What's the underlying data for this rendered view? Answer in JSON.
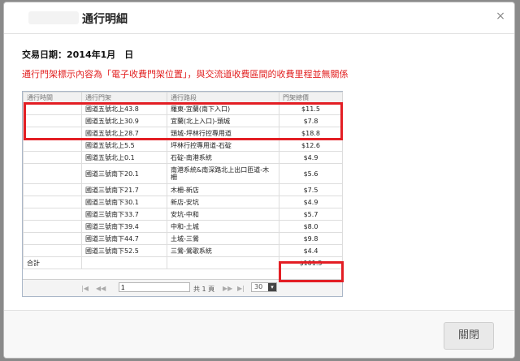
{
  "dialog": {
    "title": "通行明細",
    "close_icon": "×",
    "trade_date_label": "交易日期：2014年1月　日",
    "notice": "通行門架標示內容為「電子收費門架位置」，與交流道收費區間的收費里程並無關係"
  },
  "table": {
    "headers": [
      "通行時間",
      "通行門架",
      "通行路段",
      "門架總價"
    ],
    "rows": [
      {
        "time": "",
        "gantry": "國道五號北上43.8",
        "section": "羅東-宜蘭(南下入口)",
        "amount": "$11.5"
      },
      {
        "time": "",
        "gantry": "國道五號北上30.9",
        "section": "宜蘭(北上入口)-頭城",
        "amount": "$7.8"
      },
      {
        "time": "",
        "gantry": "國道五號北上28.7",
        "section": "頭城-坪林行控專用道",
        "amount": "$18.8"
      },
      {
        "time": "",
        "gantry": "國道五號北上5.5",
        "section": "坪林行控專用道-石碇",
        "amount": "$12.6"
      },
      {
        "time": "",
        "gantry": "國道五號北上0.1",
        "section": "石碇-南港系統",
        "amount": "$4.9"
      },
      {
        "time": "",
        "gantry": "國道三號南下20.1",
        "section": "南港系統&南深路北上出口匝道-木柵",
        "amount": "$5.6"
      },
      {
        "time": "",
        "gantry": "國道三號南下21.7",
        "section": "木柵-新店",
        "amount": "$7.5"
      },
      {
        "time": "",
        "gantry": "國道三號南下30.1",
        "section": "新店-安坑",
        "amount": "$4.9"
      },
      {
        "time": "",
        "gantry": "國道三號南下33.7",
        "section": "安坑-中和",
        "amount": "$5.7"
      },
      {
        "time": "",
        "gantry": "國道三號南下39.4",
        "section": "中和-土城",
        "amount": "$8.0"
      },
      {
        "time": "",
        "gantry": "國道三號南下44.7",
        "section": "土城-三鶯",
        "amount": "$9.8"
      },
      {
        "time": "",
        "gantry": "國道三號南下52.5",
        "section": "三鶯-鶯歌系統",
        "amount": "$4.4"
      }
    ],
    "total_label": "合計",
    "total_amount": "$101.5"
  },
  "pager": {
    "first": "|◀",
    "prev": "◀◀",
    "page_value": "1",
    "of_pages": "共 1 頁",
    "next": "▶▶",
    "last": "▶|",
    "page_size": "30",
    "caret": "▾"
  },
  "footer": {
    "close_button": "關閉"
  }
}
